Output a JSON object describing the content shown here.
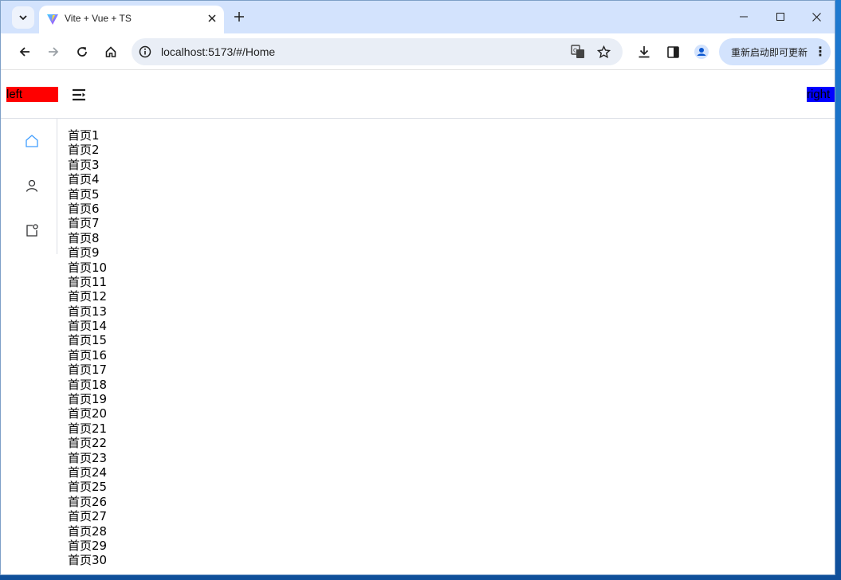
{
  "browser": {
    "tab_title": "Vite + Vue + TS",
    "url": "localhost:5173/#/Home",
    "update_button_label": "重新启动即可更新"
  },
  "app": {
    "header_left": "left",
    "header_right": "right",
    "colors": {
      "left_bg": "#ff0000",
      "right_bg": "#0000ff",
      "active_menu": "#409eff"
    },
    "sidebar_icons": [
      "home-icon",
      "user-icon",
      "profile-card-icon"
    ],
    "content_items": [
      "首页1",
      "首页2",
      "首页3",
      "首页4",
      "首页5",
      "首页6",
      "首页7",
      "首页8",
      "首页9",
      "首页10",
      "首页11",
      "首页12",
      "首页13",
      "首页14",
      "首页15",
      "首页16",
      "首页17",
      "首页18",
      "首页19",
      "首页20",
      "首页21",
      "首页22",
      "首页23",
      "首页24",
      "首页25",
      "首页26",
      "首页27",
      "首页28",
      "首页29",
      "首页30"
    ]
  }
}
